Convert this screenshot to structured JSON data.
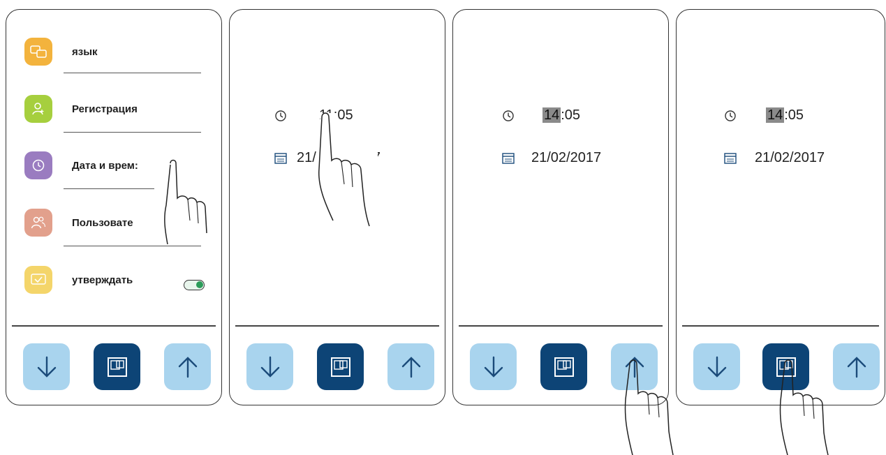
{
  "menu": {
    "items": [
      {
        "label": "язык",
        "color": "#f3b33d",
        "icon": "language-icon"
      },
      {
        "label": "Регистрация",
        "color": "#a6cf3e",
        "icon": "user-register-icon"
      },
      {
        "label": "Дата и врем:",
        "color": "#9a7cc0",
        "icon": "clock-icon"
      },
      {
        "label": "Пользовате",
        "color": "#e2a08c",
        "icon": "users-icon"
      },
      {
        "label": "утверждать",
        "color": "#f4d56a",
        "icon": "confirm-icon",
        "toggle": true
      }
    ]
  },
  "screen2": {
    "time": "11:05",
    "date_left": "21/",
    "date_right": "17"
  },
  "screen3": {
    "time_hours": "14",
    "time_rest": ":05",
    "date": "21/02/2017"
  },
  "screen4": {
    "time_hours": "14",
    "time_rest": ":05",
    "date": "21/02/2017"
  },
  "colors": {
    "nav_button": "#a9d4ee",
    "ok_button": "#0d4476",
    "arrow": "#1b4b7a",
    "highlight": "#8a8a8a"
  },
  "icons": {
    "down": "arrow-down-icon",
    "ok": "confirm-square-icon",
    "up": "arrow-up-icon",
    "hand": "pointing-hand-icon"
  }
}
